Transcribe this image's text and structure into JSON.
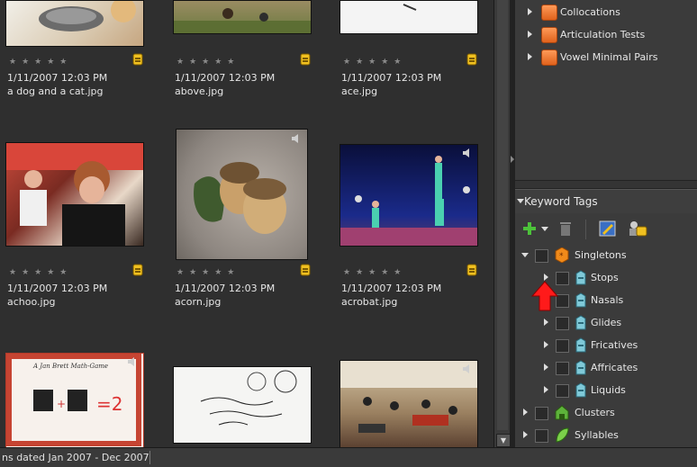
{
  "grid": {
    "items": [
      {
        "date": "1/11/2007 12:03 PM",
        "name": "a dog and a cat.jpg",
        "stars": "★★★★★"
      },
      {
        "date": "1/11/2007 12:03 PM",
        "name": "above.jpg",
        "stars": "★★★★★"
      },
      {
        "date": "1/11/2007 12:03 PM",
        "name": "ace.jpg",
        "stars": "★★★★★"
      },
      {
        "date": "1/11/2007 12:03 PM",
        "name": "achoo.jpg",
        "stars": "★★★★★"
      },
      {
        "date": "1/11/2007 12:03 PM",
        "name": "acorn.jpg",
        "stars": "★★★★★"
      },
      {
        "date": "1/11/2007 12:03 PM",
        "name": "acrobat.jpg",
        "stars": "★★★★★"
      }
    ],
    "card_text": {
      "left_title": "A Jan Brett Math-Game",
      "equation": "=2"
    }
  },
  "collections": [
    {
      "label": "Collocations",
      "icon": "orange-album-icon"
    },
    {
      "label": "Articulation Tests",
      "icon": "orange-album-icon"
    },
    {
      "label": "Vowel Minimal Pairs",
      "icon": "orange-album-icon"
    }
  ],
  "keyword_tags": {
    "header": "Keyword Tags",
    "toolbar": {
      "new_icon": "plus-icon",
      "delete_icon": "trash-icon",
      "edit_icon": "edit-icon",
      "find_icon": "people-tag-icon"
    },
    "tree": [
      {
        "label": "Singletons",
        "icon": "orange-category-icon",
        "expanded": true
      },
      {
        "label": "Stops",
        "icon": "tag-icon"
      },
      {
        "label": "Nasals",
        "icon": "tag-icon"
      },
      {
        "label": "Glides",
        "icon": "tag-icon"
      },
      {
        "label": "Fricatives",
        "icon": "tag-icon"
      },
      {
        "label": "Affricates",
        "icon": "tag-icon"
      },
      {
        "label": "Liquids",
        "icon": "tag-icon"
      },
      {
        "label": "Clusters",
        "icon": "green-category-icon"
      },
      {
        "label": "Syllables",
        "icon": "green-leaf-icon"
      }
    ]
  },
  "status_bar": {
    "text": "ns dated Jan 2007 - Dec 2007"
  },
  "colors": {
    "accent": "#ff6a1f",
    "panel": "#3b3b3b",
    "grid_bg": "#2f2f2f"
  }
}
